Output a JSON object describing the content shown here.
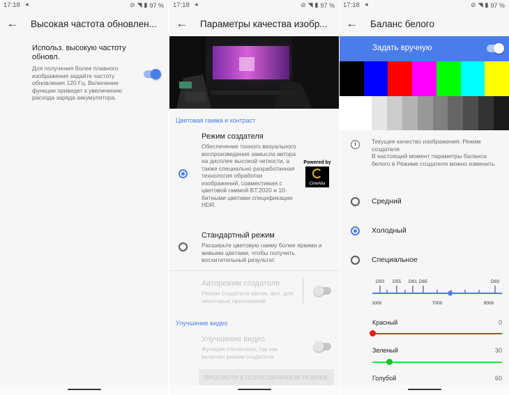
{
  "status": {
    "time": "17:18",
    "battery": "97 %"
  },
  "screen1": {
    "title": "Высокая частота обновлен...",
    "setting_title": "Использ. высокую частоту обновл.",
    "setting_desc": "Для получения более плавного изображения задайте частоту обновления 120 Гц. Включение функции приведет к увеличению расхода заряда аккумулятора.",
    "toggle_on": true
  },
  "screen2": {
    "title": "Параметры качества изобр...",
    "section_color": "Цветовая гамма и контраст",
    "creator_title": "Режим создателя",
    "creator_desc": "Обеспечение точного визуального воспроизведения замысла автора на дисплее высокой четкости, а также специально разработанная технология обработки изображений, совместимая с цветовой гаммой BT.2020 и 10-битными цветами спецификации HDR.",
    "powered_by": "Powered by",
    "cinealta": "CineAlta",
    "standard_title": "Стандартный режим",
    "standard_desc": "Расширьте цветовую гамму более яркими и живыми цветами, чтобы получить восхитительный результат.",
    "auto_title": "Авторежим создателя",
    "auto_desc": "Режим создателя автом. вкл. для некоторых приложений",
    "section_video": "Улучшение видео",
    "video_title": "Улучшение видео",
    "video_desc": "Функция отключена, так как включен режим создателя",
    "preview_button": "ПРОСМОТР В ПОЛНОЭКРАННОМ РЕЖИМЕ"
  },
  "screen3": {
    "title": "Баланс белого",
    "manual_label": "Задать вручную",
    "accent": "#4a7de9",
    "color_bars": [
      "#000000",
      "#0000ff",
      "#ff0000",
      "#ff00ff",
      "#00ff00",
      "#00ffff",
      "#ffff00"
    ],
    "gray_bars": [
      "#ffffff",
      "#e6e6e6",
      "#cccccc",
      "#b3b3b3",
      "#999999",
      "#808080",
      "#666666",
      "#4d4d4d",
      "#333333",
      "#1a1a1a"
    ],
    "info_text": "Текущее качество изображения: Режим создателя\nВ настоящий момент параметры баланса белого в Режиме создателя можно изменить",
    "options": [
      {
        "label": "Средний",
        "selected": false
      },
      {
        "label": "Холодный",
        "selected": true
      },
      {
        "label": "Специальное",
        "selected": false
      }
    ],
    "temp_labels": [
      "D50",
      "D55",
      "D61",
      "D65",
      "D93"
    ],
    "temp_scale": [
      "5000",
      "7000",
      "9000"
    ],
    "temp_value": 0.6,
    "red_label": "Красный",
    "red_value": "0",
    "green_label": "Зеленый",
    "green_value": "30",
    "blue_label": "Голубой",
    "blue_value": "60"
  }
}
